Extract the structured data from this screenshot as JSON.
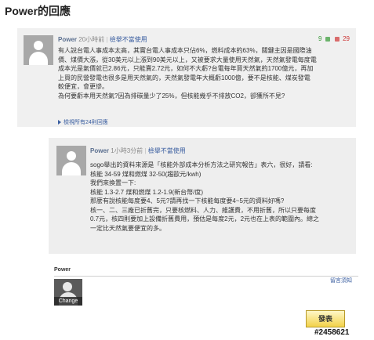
{
  "page": {
    "title": "Power的回應"
  },
  "comments": [
    {
      "author": "Power",
      "time": "20小時前",
      "separator": "|",
      "report_label": "檢舉不當使用",
      "upvotes": "9",
      "downvotes": "29",
      "lines": [
        "有人說台電人事成本太高，其實台電人事成本只佔6%，燃料成本約63%，關鍵主因是國際油",
        "價、煤價大漲，從30美元以上漲到90美元以上，又被要求大量使用天然氣，天然氣發電每度電",
        "成本光是氣價就已2.86元，只能賣2.72元，如何不大虧?台電每年買天然氣約1700億元，再加",
        "上買的民營發電也很多是用天然氣的，天然氣發電年大概虧1000億，要不是核能、煤炭發電",
        "較便宜，會更慘。",
        "為何要虧本用天然氣?因為排碳量少了25%，但核能幾乎不排放CO2，卻獲所不見?"
      ],
      "more_label": "檢視所有24則回應"
    },
    {
      "author": "Power",
      "time": "1小時3分前",
      "separator": "|",
      "report_label": "檢舉不當使用",
      "lines": [
        "sogo舉出的資料來源是「核能外部成本分析方法之研究報告」表六，很好，請看:",
        "核能 34-59 煤和燃煤 32-50(趨歐元/kwh)",
        "我們來換置一下:",
        "核能 1.3-2.7 煤和燃煤 1.2-1.9(新台幣/度)",
        "那麼有說核能每度要4、5元?請再找一下核能每度要4~5元的資料好嗎?",
        "核一、二、三廠已折舊完，只要核燃料、人力、維護費，不用折舊，所以只要每度",
        "0.7元，核四則要加上設備折舊費用，預估是每度2元，2元也在上表的範圍內。總之",
        "一定比天然氣要便宜的多。"
      ]
    }
  ],
  "compose": {
    "author": "Power",
    "rules_label": "留言須知",
    "change_label": "Change",
    "submit_label": "發表"
  },
  "watermark": "#2458621"
}
